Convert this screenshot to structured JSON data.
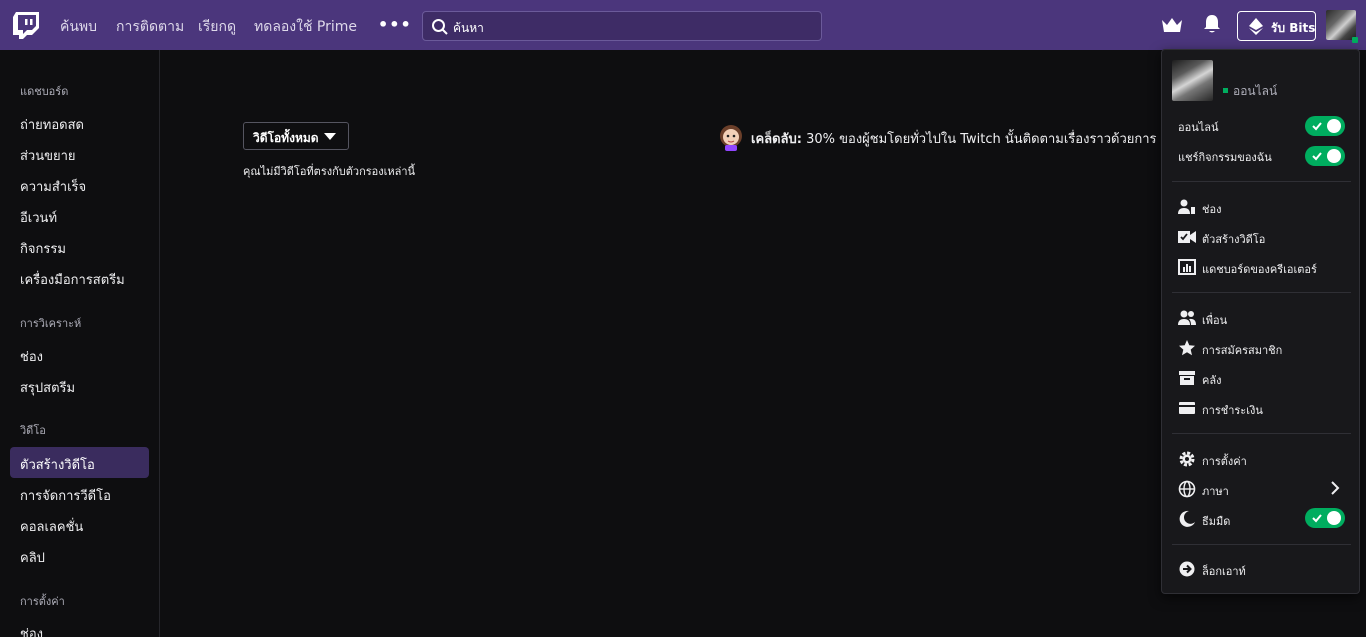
{
  "topnav": {
    "links": [
      "ค้นพบ",
      "การติดตาม",
      "เรียกดู",
      "ทดลองใช้ Prime"
    ],
    "more": "•••",
    "search_placeholder": "ค้นหา",
    "bits_label": "รับ Bits",
    "brand_color": "#4b367c"
  },
  "sidebar": {
    "sections": [
      {
        "heading": "แดชบอร์ด",
        "items": [
          "ถ่ายทอดสด",
          "ส่วนขยาย",
          "ความสำเร็จ",
          "อีเวนท์",
          "กิจกรรม",
          "เครื่องมือการสตรีม"
        ]
      },
      {
        "heading": "การวิเคราะห์",
        "items": [
          "ช่อง",
          "สรุปสตรีม"
        ]
      },
      {
        "heading": "วิดีโอ",
        "items": [
          "ตัวสร้างวิดีโอ",
          "การจัดการวีดีโอ",
          "คอลเลคชั่น",
          "คลิป"
        ]
      },
      {
        "heading": "การตั้งค่า",
        "items": [
          "ช่อง"
        ]
      }
    ],
    "active_item": "ตัวสร้างวิดีโอ"
  },
  "main": {
    "filter_label": "วิดีโอทั้งหมด",
    "empty_message": "คุณไม่มีวิดีโอที่ตรงกับตัวกรองเหล่านี้",
    "tip_bold": "เคล็ดลับ:",
    "tip_text": " 30% ของผู้ชมโดยทั่วไปใน Twitch นั้นติดตามเรื่องราวด้วยการ"
  },
  "menu": {
    "status": "ออนไลน์",
    "toggles": [
      {
        "label": "ออนไลน์",
        "on": true
      },
      {
        "label": "แชร์กิจกรรมของฉัน",
        "on": true
      }
    ],
    "group1": [
      {
        "icon": "channel-icon",
        "label": "ช่อง"
      },
      {
        "icon": "video-producer-icon",
        "label": "ตัวสร้างวิดีโอ"
      },
      {
        "icon": "dashboard-icon",
        "label": "แดชบอร์ดของครีเอเตอร์"
      }
    ],
    "group2": [
      {
        "icon": "friends-icon",
        "label": "เพื่อน"
      },
      {
        "icon": "star-icon",
        "label": "การสมัครสมาชิก"
      },
      {
        "icon": "inventory-icon",
        "label": "คลัง"
      },
      {
        "icon": "wallet-icon",
        "label": "การชำระเงิน"
      }
    ],
    "group3": [
      {
        "icon": "gear-icon",
        "label": "การตั้งค่า"
      },
      {
        "icon": "globe-icon",
        "label": "ภาษา"
      },
      {
        "icon": "moon-icon",
        "label": "ธีมมืด",
        "on": true
      }
    ],
    "logout": {
      "icon": "logout-icon",
      "label": "ล็อกเอาท์"
    },
    "toggle_color": "#00ad5f"
  }
}
